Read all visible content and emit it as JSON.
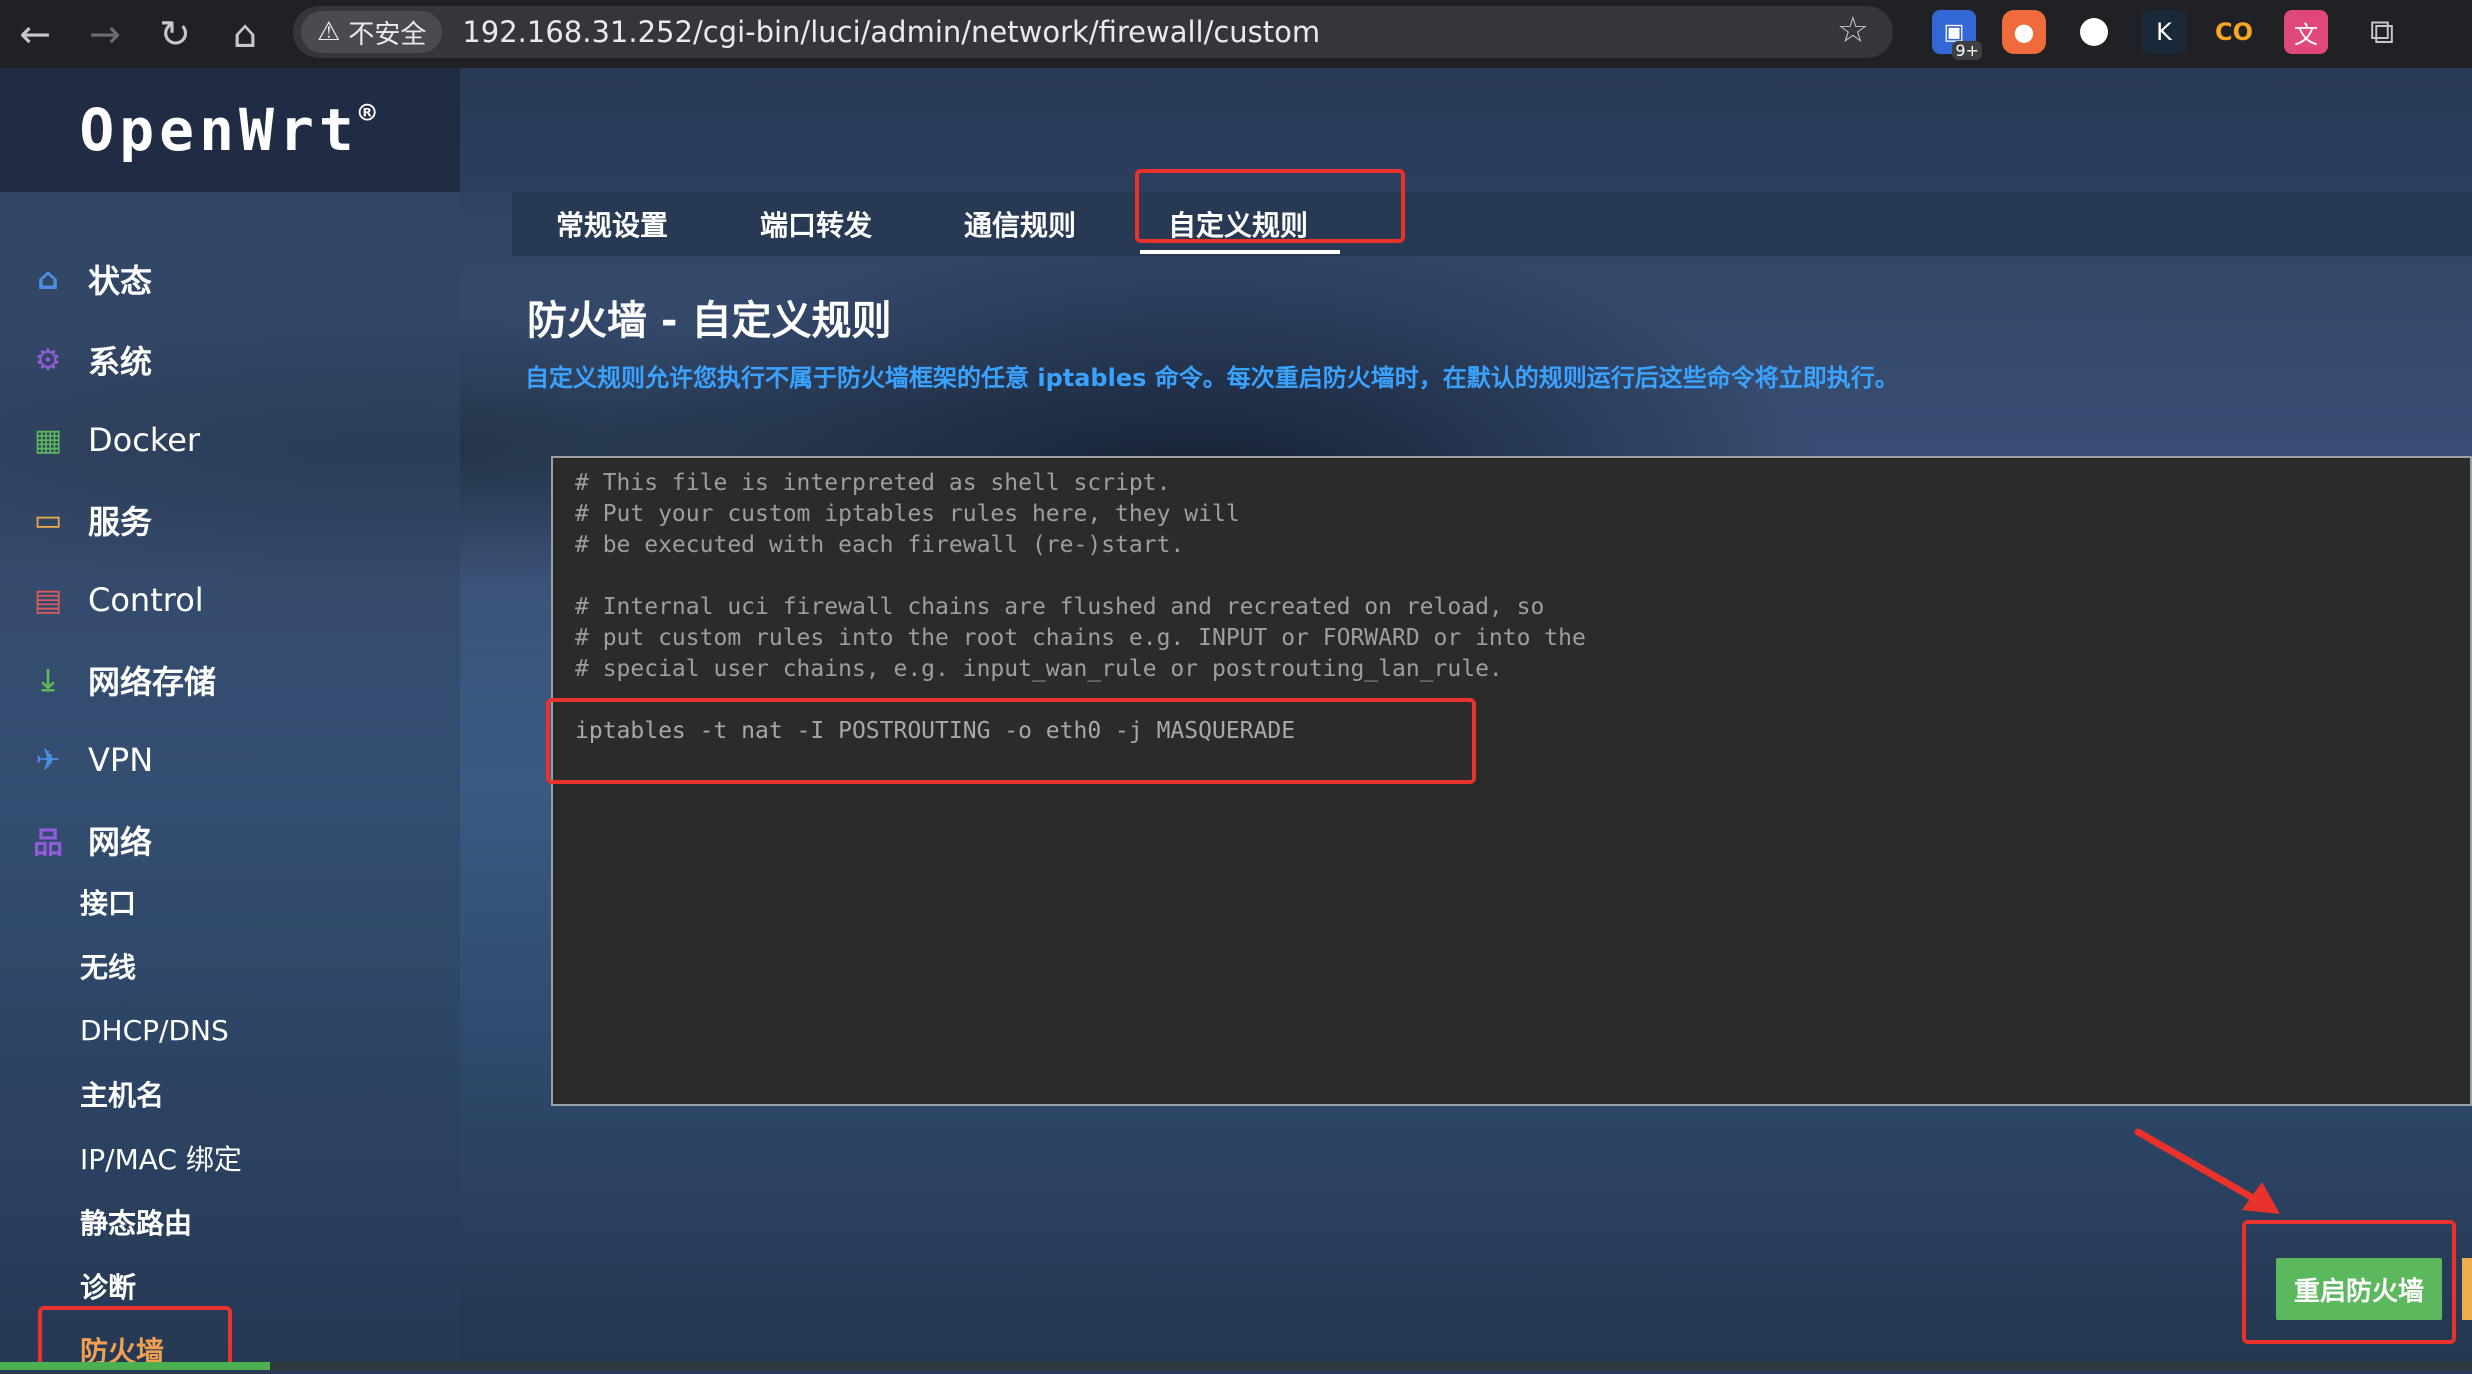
{
  "browser": {
    "security_label": "不安全",
    "url": "192.168.31.252/cgi-bin/luci/admin/network/firewall/custom",
    "ext_badge": "9+",
    "extensions": [
      "save-extension",
      "orange-extension",
      "circle-extension",
      "k-extension",
      "co-extension",
      "translate-extension",
      "puzzle-extension"
    ]
  },
  "brand": {
    "name": "OpenWrt",
    "mark": "®"
  },
  "sidebar": {
    "items": [
      {
        "label": "状态",
        "icon": "home-icon"
      },
      {
        "label": "系统",
        "icon": "gear-icon"
      },
      {
        "label": "Docker",
        "icon": "grid-icon"
      },
      {
        "label": "服务",
        "icon": "services-icon"
      },
      {
        "label": "Control",
        "icon": "calendar-icon"
      },
      {
        "label": "网络存储",
        "icon": "download-icon"
      },
      {
        "label": "VPN",
        "icon": "vpn-icon"
      },
      {
        "label": "网络",
        "icon": "network-icon"
      }
    ],
    "subitems": [
      {
        "label": "接口"
      },
      {
        "label": "无线"
      },
      {
        "label": "DHCP/DNS"
      },
      {
        "label": "主机名"
      },
      {
        "label": "IP/MAC 绑定"
      },
      {
        "label": "静态路由"
      },
      {
        "label": "诊断"
      },
      {
        "label": "防火墙",
        "active": true
      }
    ]
  },
  "tabs": [
    {
      "label": "常规设置"
    },
    {
      "label": "端口转发"
    },
    {
      "label": "通信规则"
    },
    {
      "label": "自定义规则",
      "active": true
    }
  ],
  "page": {
    "title": "防火墙 - 自定义规则",
    "description": "自定义规则允许您执行不属于防火墙框架的任意 iptables 命令。每次重启防火墙时，在默认的规则运行后这些命令将立即执行。"
  },
  "editor": {
    "lines": [
      "# This file is interpreted as shell script.",
      "# Put your custom iptables rules here, they will",
      "# be executed with each firewall (re-)start.",
      "",
      "# Internal uci firewall chains are flushed and recreated on reload, so",
      "# put custom rules into the root chains e.g. INPUT or FORWARD or into the",
      "# special user chains, e.g. input_wan_rule or postrouting_lan_rule.",
      "",
      "iptables -t nat -I POSTROUTING -o eth0 -j MASQUERADE"
    ]
  },
  "actions": {
    "restart_label": "重启防火墙"
  },
  "colors": {
    "accent_link": "#3aa2ff",
    "annotation": "#e8322b",
    "button_green": "#5cb85c",
    "active_sub": "#f0a050"
  }
}
